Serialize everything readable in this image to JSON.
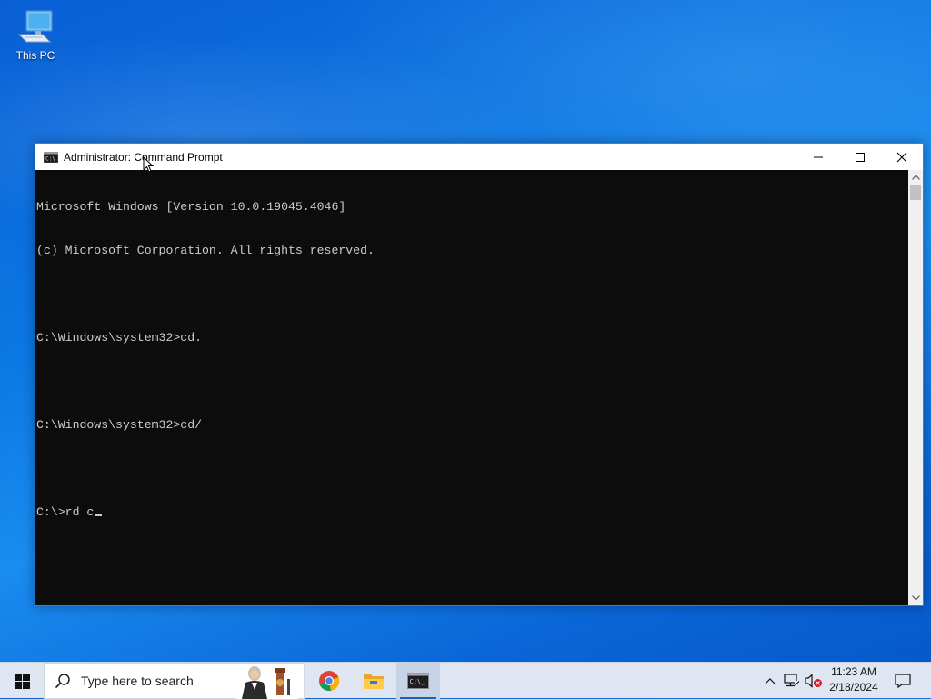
{
  "desktop": {
    "icons": [
      {
        "label": "This PC",
        "icon": "this-pc-icon"
      }
    ]
  },
  "window": {
    "title": "Administrator: Command Prompt",
    "controls": {
      "minimize": "minimize-icon",
      "maximize": "maximize-icon",
      "close": "close-icon"
    },
    "console_lines": [
      "Microsoft Windows [Version 10.0.19045.4046]",
      "(c) Microsoft Corporation. All rights reserved.",
      "",
      "C:\\Windows\\system32>cd.",
      "",
      "C:\\Windows\\system32>cd/",
      "",
      "C:\\>rd c"
    ],
    "colors": {
      "console_bg": "#0c0c0c",
      "console_fg": "#cccccc"
    }
  },
  "taskbar": {
    "search": {
      "placeholder": "Type here to search"
    },
    "apps": [
      "chrome-icon",
      "file-explorer-icon",
      "command-prompt-icon"
    ],
    "clock": {
      "time": "11:23 AM",
      "date": "2/18/2024"
    },
    "colors": {
      "background": "#dfe6f2",
      "active_indicator": "#1a5fb4"
    }
  }
}
